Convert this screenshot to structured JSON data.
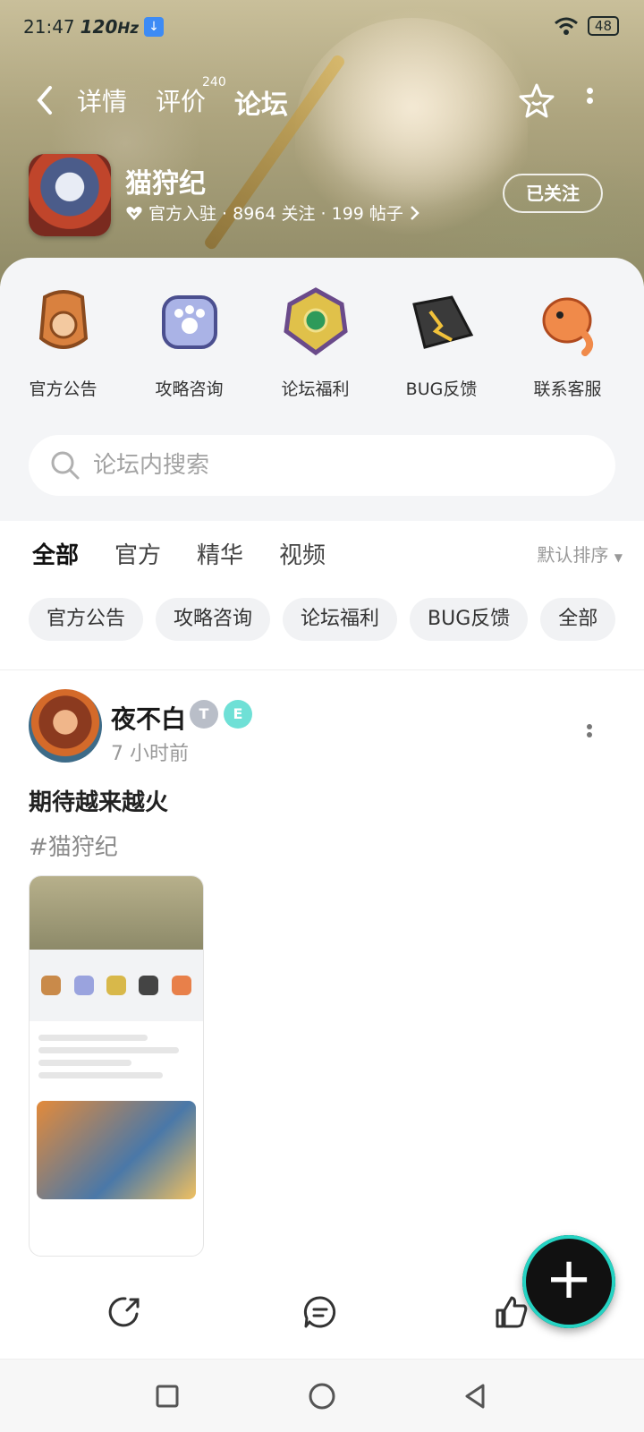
{
  "status_bar": {
    "time": "21:47",
    "refresh": "120",
    "hz_unit": "Hz",
    "battery": "48"
  },
  "top_nav": {
    "tabs": [
      {
        "label": "详情"
      },
      {
        "label": "评价",
        "badge": "240"
      },
      {
        "label": "论坛",
        "active": true
      }
    ]
  },
  "game": {
    "name": "猫狩纪",
    "meta": "官方入驻 · 8964 关注 · 199 帖子",
    "follow_label": "已关注"
  },
  "categories": [
    {
      "label": "官方公告",
      "icon": "official-announcement-icon"
    },
    {
      "label": "攻略咨询",
      "icon": "strategy-icon"
    },
    {
      "label": "论坛福利",
      "icon": "forum-benefits-icon"
    },
    {
      "label": "BUG反馈",
      "icon": "bug-feedback-icon"
    },
    {
      "label": "联系客服",
      "icon": "customer-service-icon"
    }
  ],
  "search": {
    "placeholder": "论坛内搜索"
  },
  "filter_tabs": [
    {
      "label": "全部",
      "active": true
    },
    {
      "label": "官方"
    },
    {
      "label": "精华"
    },
    {
      "label": "视频"
    }
  ],
  "sort_label": "默认排序",
  "chips": [
    "官方公告",
    "攻略咨询",
    "论坛福利",
    "BUG反馈",
    "全部"
  ],
  "post": {
    "username": "夜不白",
    "time": "7 小时前",
    "title": "期待越来越火",
    "tag": "#猫狩纪"
  },
  "colors": {
    "accent": "#25d3c3",
    "text": "#1a1a1a",
    "muted": "#999999"
  }
}
